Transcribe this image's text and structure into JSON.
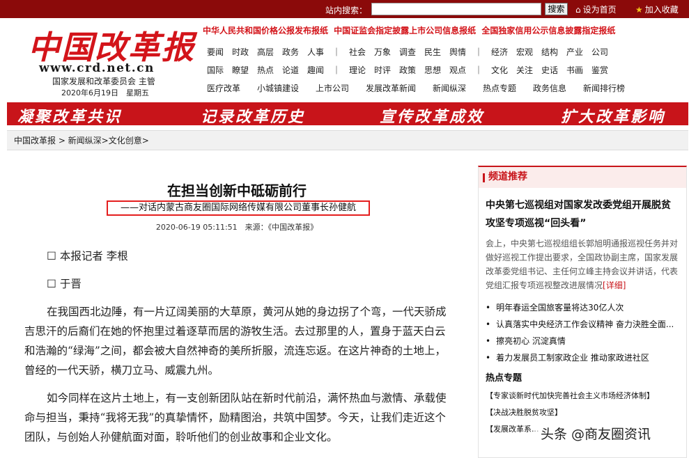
{
  "topbar": {
    "search_label": "站内搜索：",
    "search_value": "",
    "search_button": "搜索",
    "home_label": "设为首页",
    "fav_label": "加入收藏"
  },
  "header": {
    "logo_text": "中国改革报",
    "url": "www.crd.net.cn",
    "sponsor": "国家发展和改革委员会 主管",
    "date": "2020年6月19日　星期五",
    "slogans": "中华人民共和国价格公报发布报纸 中国证监会指定披露上市公司信息报纸 全国独家信用公示信息披露指定报纸",
    "nav_row1": "要闻　时政　高层　政务　人事　｜　社会　万象　调查　民生　舆情　｜　经济　宏观　结构　产业　公司",
    "nav_row2": "国际　瞭望　热点　论道　趣闻　｜　理论　时评　政策　思想　观点　｜　文化　关注　史话　书画　鉴赏",
    "nav_row3": "医疗改革　　小城镇建设　　上市公司　　发展改革新闻　　新闻纵深　　热点专题　　政务信息　　新闻排行榜"
  },
  "banner": {
    "s1": "凝聚改革共识",
    "s2": "记录改革历史",
    "s3": "宣传改革成效",
    "s4": "扩大改革影响"
  },
  "breadcrumb": "中国改革报 > 新闻纵深>文化创意>",
  "article": {
    "title": "在担当创新中砥砺前行",
    "subtitle": "——对话内蒙古商友圈国际网络传媒有限公司董事长孙健航",
    "meta": "2020-06-19 05:11:51　来源：《中国改革报》",
    "reporter1": "☐ 本报记者 李根",
    "reporter2": "☐ 于晋",
    "para1": "在我国西北边陲，有一片辽阔美丽的大草原，黄河从她的身边拐了个弯，一代天骄成吉思汗的后裔们在她的怀抱里过着逐草而居的游牧生活。去过那里的人，置身于蓝天白云和浩瀚的“绿海”之间，都会被大自然神奇的美所折服，流连忘返。在这片神奇的土地上，曾经的一代天骄，横刀立马、威震九州。",
    "para2": "如今同样在这片土地上，有一支创新团队站在新时代前沿，满怀热血与激情、承载使命与担当，秉持“我将无我”的真挚情怀，励精图治，共筑中国梦。今天，让我们走近这个团队，与创始人孙健航面对面，聆听他们的创业故事和企业文化。"
  },
  "sidebar": {
    "header": "频道推荐",
    "feature_title": "中央第七巡视组对国家发改委党组开展脱贫攻坚专项巡视“回头看”",
    "feature_desc": "会上，中央第七巡视组组长郭旭明通报巡视任务并对做好巡视工作提出要求，全国政协副主席，国家发展改革委党组书记、主任何立峰主持会议并讲话，代表党组汇报专项巡视整改进展情况",
    "feature_more": "[详细]",
    "items": [
      "明年春运全国旅客量将达30亿人次",
      "认真落实中央经济工作会议精神 奋力決胜全面...",
      "擦亮初心 沉淀真情",
      "着力发展员工制家政企业 推动家政进社区"
    ],
    "hot_header": "热点专题",
    "hot_items": [
      "【专家谈新时代加快完善社会主义市场经济体制】",
      "【决战决胜脱贫攻坚】",
      "【发展改革系..."
    ]
  },
  "watermark": "头条 @商友圈资讯"
}
